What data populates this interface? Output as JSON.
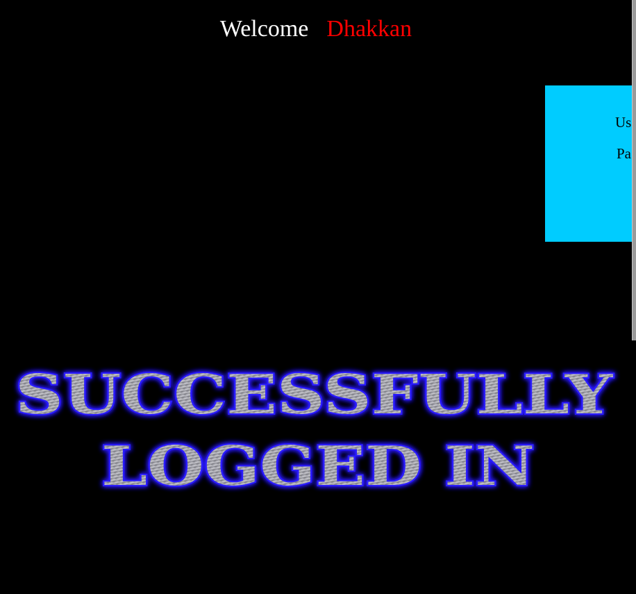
{
  "header": {
    "welcome_word": "Welcome",
    "user_name": "Dhakkan"
  },
  "login_form": {
    "username_label": "Us",
    "password_label": "Pa"
  },
  "banner": {
    "line1": "SUCCESSFULLY",
    "line2": "LOGGED IN"
  },
  "colors": {
    "page_background": "#000000",
    "welcome_text": "#ffffff",
    "user_name": "#ff0000",
    "login_box": "#00ccff",
    "banner_glow": "#2a1cff",
    "banner_metal": "#a8a8b0"
  }
}
